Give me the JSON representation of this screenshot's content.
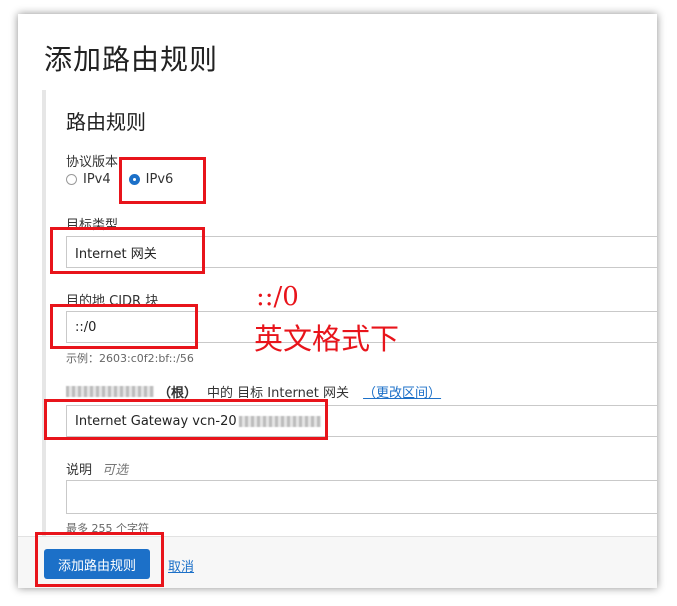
{
  "page": {
    "title": "添加路由规则"
  },
  "section": {
    "title": "路由规则"
  },
  "protocol": {
    "label": "协议版本",
    "options": [
      {
        "label": "IPv4",
        "checked": false
      },
      {
        "label": "IPv6",
        "checked": true
      }
    ]
  },
  "target_type": {
    "label": "目标类型",
    "value": "Internet 网关"
  },
  "destination_cidr": {
    "label": "目的地 CIDR 块",
    "value": "::/0",
    "example": "示例：2603:c0f2:bf::/56"
  },
  "target_gateway": {
    "label_bold": "（根）",
    "label_suffix": "中的 目标 Internet 网关",
    "change_link": "（更改区间）",
    "value": "Internet Gateway vcn-20"
  },
  "description": {
    "label": "说明",
    "optional": "可选",
    "value": "",
    "hint": "最多 255 个字符"
  },
  "footer": {
    "submit_label": "添加路由规则",
    "cancel_label": "取消"
  },
  "annotation": {
    "line1": "::/0",
    "line2": "英文格式下"
  },
  "colors": {
    "primary": "#1c70c8",
    "annotation_red": "#e8141b"
  }
}
